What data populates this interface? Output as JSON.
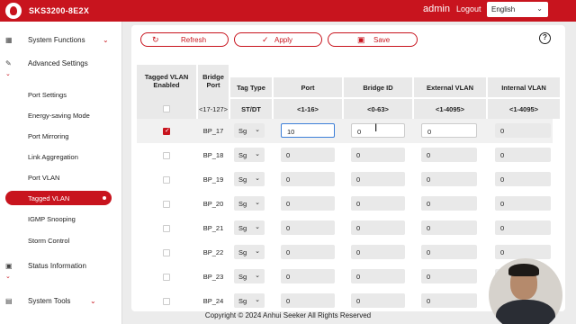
{
  "header": {
    "model": "SKS3200-8E2X",
    "user": "admin",
    "logout": "Logout",
    "language": "English"
  },
  "sidebar": {
    "system_functions": "System Functions",
    "advanced_settings": "Advanced Settings",
    "items": [
      "Port Settings",
      "Energy-saving Mode",
      "Port Mirroring",
      "Link Aggregation",
      "Port VLAN",
      "Tagged VLAN",
      "IGMP Snooping",
      "Storm Control"
    ],
    "active_item": "Tagged VLAN",
    "status_information": "Status Information",
    "system_tools": "System Tools"
  },
  "toolbar": {
    "refresh": "Refresh",
    "apply": "Apply",
    "save": "Save",
    "help": "?"
  },
  "table": {
    "headers": {
      "tagged_vlan_enabled_1": "Tagged VLAN",
      "tagged_vlan_enabled_2": "Enabled",
      "bridge_port_1": "Bridge",
      "bridge_port_2": "Port",
      "tag_type": "Tag Type",
      "port": "Port",
      "bridge_id": "Bridge ID",
      "external_vlan": "External VLAN",
      "internal_vlan": "Internal VLAN"
    },
    "ranges": {
      "bridge_port": "<17-127>",
      "tag_type": "ST/DT",
      "port": "<1-16>",
      "bridge_id": "<0-63>",
      "external_vlan": "<1-4095>",
      "internal_vlan": "<1-4095>"
    },
    "rows": [
      {
        "enabled": true,
        "bridge_port": "BP_17",
        "tag_type": "Sg",
        "port": "10",
        "bridge_id": "0",
        "external_vlan": "0",
        "internal_vlan": "0"
      },
      {
        "enabled": false,
        "bridge_port": "BP_18",
        "tag_type": "Sg",
        "port": "0",
        "bridge_id": "0",
        "external_vlan": "0",
        "internal_vlan": "0"
      },
      {
        "enabled": false,
        "bridge_port": "BP_19",
        "tag_type": "Sg",
        "port": "0",
        "bridge_id": "0",
        "external_vlan": "0",
        "internal_vlan": "0"
      },
      {
        "enabled": false,
        "bridge_port": "BP_20",
        "tag_type": "Sg",
        "port": "0",
        "bridge_id": "0",
        "external_vlan": "0",
        "internal_vlan": "0"
      },
      {
        "enabled": false,
        "bridge_port": "BP_21",
        "tag_type": "Sg",
        "port": "0",
        "bridge_id": "0",
        "external_vlan": "0",
        "internal_vlan": "0"
      },
      {
        "enabled": false,
        "bridge_port": "BP_22",
        "tag_type": "Sg",
        "port": "0",
        "bridge_id": "0",
        "external_vlan": "0",
        "internal_vlan": "0"
      },
      {
        "enabled": false,
        "bridge_port": "BP_23",
        "tag_type": "Sg",
        "port": "0",
        "bridge_id": "0",
        "external_vlan": "0",
        "internal_vlan": "0"
      },
      {
        "enabled": false,
        "bridge_port": "BP_24",
        "tag_type": "Sg",
        "port": "0",
        "bridge_id": "0",
        "external_vlan": "0",
        "internal_vlan": "0"
      }
    ]
  },
  "footer": "Copyright © 2024 Anhui Seeker All Rights Reserved",
  "colors": {
    "accent": "#c8141e",
    "focus": "#3d7fd8"
  }
}
